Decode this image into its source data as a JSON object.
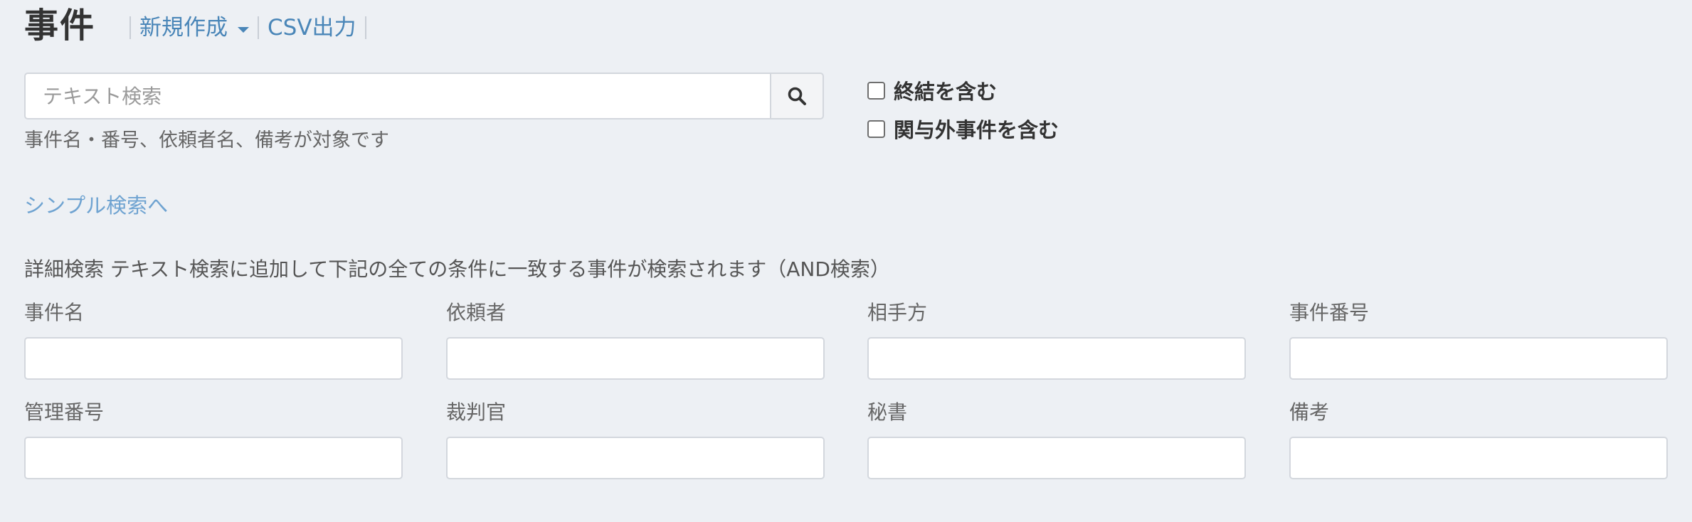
{
  "header": {
    "title": "事件",
    "new_label": "新規作成",
    "csv_label": "CSV出力"
  },
  "search": {
    "placeholder": "テキスト検索",
    "help": "事件名・番号、依頼者名、備考が対象です"
  },
  "filters": {
    "include_closed": "終結を含む",
    "include_unrelated": "関与外事件を含む"
  },
  "simple_search_link": "シンプル検索へ",
  "advanced": {
    "heading": "詳細検索 テキスト検索に追加して下記の全ての条件に一致する事件が検索されます（AND検索）",
    "fields": [
      {
        "label": "事件名"
      },
      {
        "label": "依頼者"
      },
      {
        "label": "相手方"
      },
      {
        "label": "事件番号"
      },
      {
        "label": "管理番号"
      },
      {
        "label": "裁判官"
      },
      {
        "label": "秘書"
      },
      {
        "label": "備考"
      }
    ]
  },
  "icons": {
    "search": "search-icon",
    "dropdown": "caret-down-icon"
  },
  "colors": {
    "link": "#4a86b8",
    "light_link": "#6fa3d1",
    "background": "#edf0f4"
  }
}
